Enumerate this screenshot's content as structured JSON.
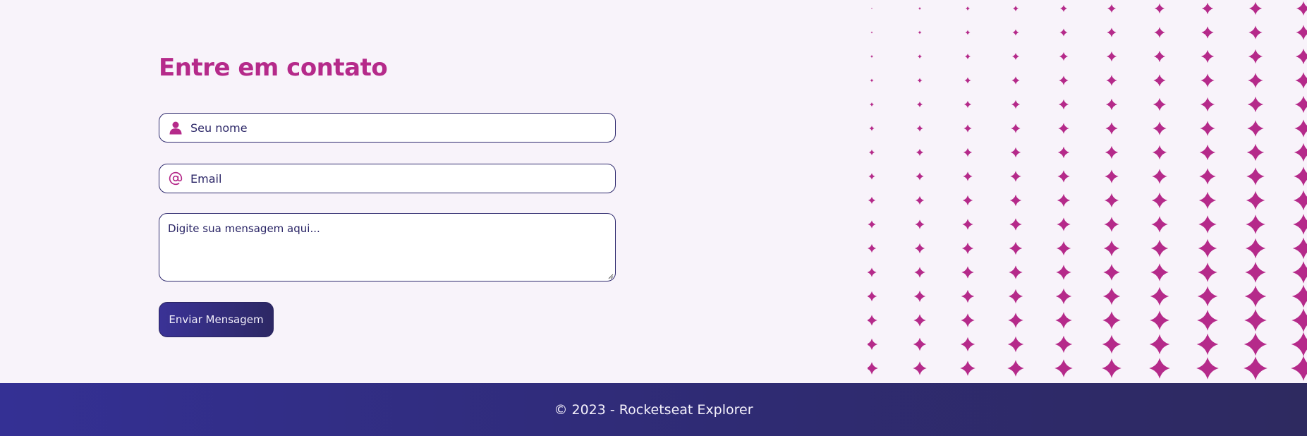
{
  "contact": {
    "title": "Entre em contato",
    "name_placeholder": "Seu nome",
    "email_placeholder": "Email",
    "message_placeholder": "Digite sua mensagem aqui...",
    "submit_label": "Enviar Mensagem",
    "name_icon": "user-icon",
    "email_icon": "at-sign-icon"
  },
  "decoration": {
    "pattern": "sparkle-stars",
    "color": "#b52a8a"
  },
  "footer": {
    "text": "© 2023 - Rocketseat Explorer"
  },
  "colors": {
    "accent": "#b52a8a",
    "primary": "#2f2a7a",
    "background": "#f8f3fa"
  }
}
